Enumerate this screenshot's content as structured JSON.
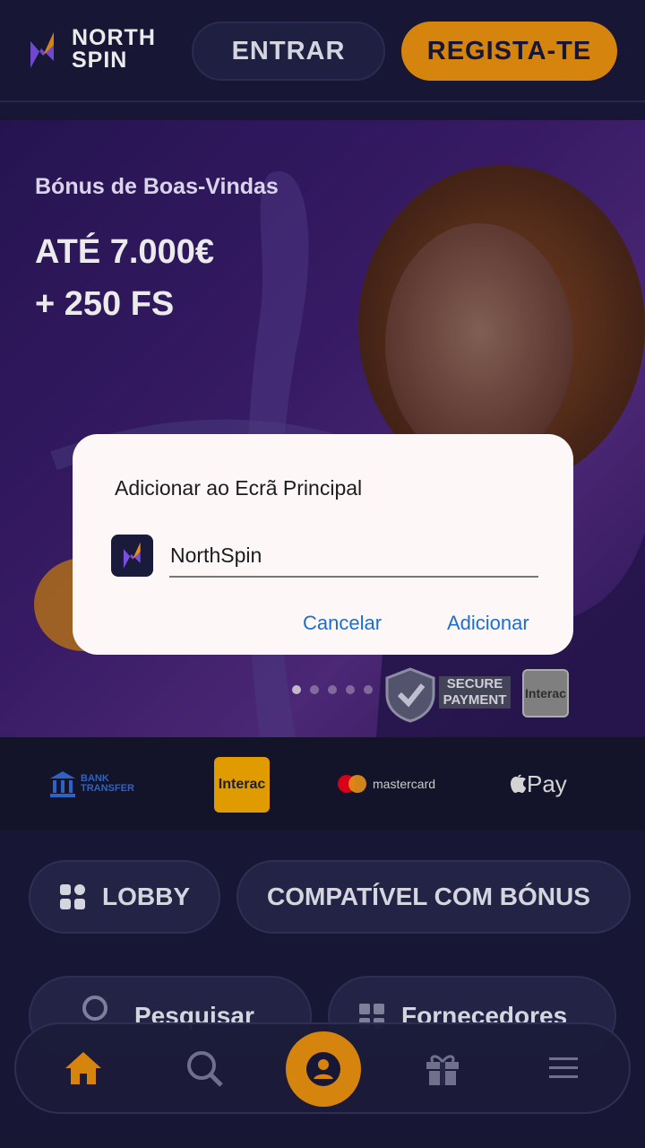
{
  "header": {
    "logo_line1": "NORTH",
    "logo_line2": "SPIN",
    "login_label": "ENTRAR",
    "register_label": "REGISTA-TE"
  },
  "banner": {
    "subtitle": "Bónus de Boas-Vindas",
    "title_line1": "ATÉ 7.000€",
    "title_line2": "+ 250 FS",
    "secure_line1": "SECURE",
    "secure_line2": "PAYMENT",
    "interac_label": "Interac"
  },
  "payments": {
    "bank_line1": "BANK",
    "bank_line2": "TRANSFER",
    "interac_label": "Interac",
    "mastercard_label": "mastercard",
    "applepay_label": "Pay"
  },
  "categories": {
    "lobby_label": "LOBBY",
    "bonus_compatible_label": "COMPATÍVEL COM BÓNUS",
    "search_label": "Pesquisar",
    "providers_label": "Fornecedores"
  },
  "dialog": {
    "title": "Adicionar ao Ecrã Principal",
    "app_name_value": "NorthSpin",
    "cancel_label": "Cancelar",
    "add_label": "Adicionar"
  },
  "colors": {
    "background": "#1a1a3a",
    "accent_orange": "#e8900f",
    "dialog_bg": "#fdf8f7",
    "dialog_button": "#1a6fd1"
  },
  "icons": [
    "northspin-logo-icon",
    "home-icon",
    "search-icon",
    "user-circle-icon",
    "gift-icon",
    "menu-icon",
    "grid-icon",
    "shield-check-icon",
    "bank-icon",
    "apple-icon"
  ]
}
